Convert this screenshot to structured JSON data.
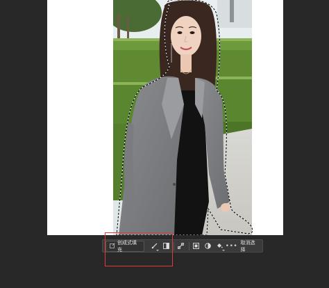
{
  "toolbar": {
    "generative_fill_label": "创成式填充",
    "more_label": "•••",
    "cancel_label": "取消选择"
  },
  "icons": {
    "generative_fill": "generative-fill-icon",
    "brush": "brush-icon",
    "invert": "invert-selection-icon",
    "transform": "transform-icon",
    "mask": "mask-icon",
    "adjust": "adjustment-icon",
    "fill": "fill-bucket-icon"
  },
  "colors": {
    "highlight": "#e03a3a",
    "toolbar_bg": "#3a3a3a",
    "workspace_bg": "#282828"
  }
}
